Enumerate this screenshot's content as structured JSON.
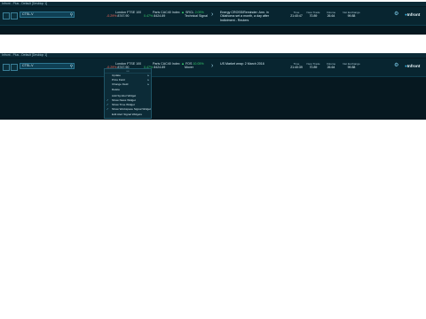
{
  "colors": {
    "bg": "#061820",
    "toolbar": "#082530",
    "negative": "#ff6b5c",
    "positive": "#39d16f",
    "accent": "#38b3e0"
  },
  "windows": [
    {
      "title": "Infront - Plus - Default [Desktop 1]",
      "search": {
        "value": "CTSL.V",
        "icon": "search-icon"
      },
      "quotes": [
        {
          "name": "London FTSE 100",
          "change": "-0.29%",
          "value": "8747.90"
        },
        {
          "name": "Paris CAC40 Index",
          "change": "0.47%",
          "value": "8424.89"
        },
        {
          "name": "SRCL",
          "change": "2.05%",
          "sub": "Technical Signal"
        }
      ],
      "news": "Energy CROSS/Reminder: Ann. in Oklahoma set a month, a day after Indictment - Reuters",
      "stats": [
        {
          "label": "Time",
          "value": "21:40:47"
        },
        {
          "label": "New Trade",
          "value": "70.89"
        },
        {
          "label": "Volume",
          "value": "26.64"
        },
        {
          "label": "Net Exchange",
          "value": "99.88"
        }
      ],
      "logo": "Infront"
    },
    {
      "title": "Infront - Plus - Default [Desktop 1]",
      "search": {
        "value": "CTSL.V",
        "icon": "search-icon"
      },
      "quotes": [
        {
          "name": "London FTSE 100",
          "change": "-0.29%",
          "value": "8747.90"
        },
        {
          "name": "Paris CAC40 Index",
          "change": "0.47%",
          "value": "8424.89"
        },
        {
          "name": "FOS",
          "change": "10.05%",
          "sub": "Mover"
        }
      ],
      "news": "US Market wrap: 2 March 2016",
      "stats": [
        {
          "label": "Time",
          "value": "21:40:39"
        },
        {
          "label": "New Trade",
          "value": "70.89"
        },
        {
          "label": "Volume",
          "value": "26.64"
        },
        {
          "label": "Net Exchange",
          "value": "99.88"
        }
      ],
      "logo": "Infront"
    }
  ],
  "menu": {
    "header": "•••",
    "items": [
      {
        "label": "Update",
        "arrow": true
      },
      {
        "label": "Price Field",
        "arrow": true
      },
      {
        "label": "Change Field",
        "arrow": true
      },
      {
        "label": "Delete",
        "arrow": false
      },
      {
        "label": "Add Symbol Widget",
        "check": false
      },
      {
        "label": "Show News Widget",
        "check": true
      },
      {
        "label": "Show Time Widget",
        "check": true
      },
      {
        "label": "Show Workspace Signal Widget",
        "check": true
      },
      {
        "label": "Edit Alert Signal Widgets",
        "check": false
      }
    ]
  }
}
